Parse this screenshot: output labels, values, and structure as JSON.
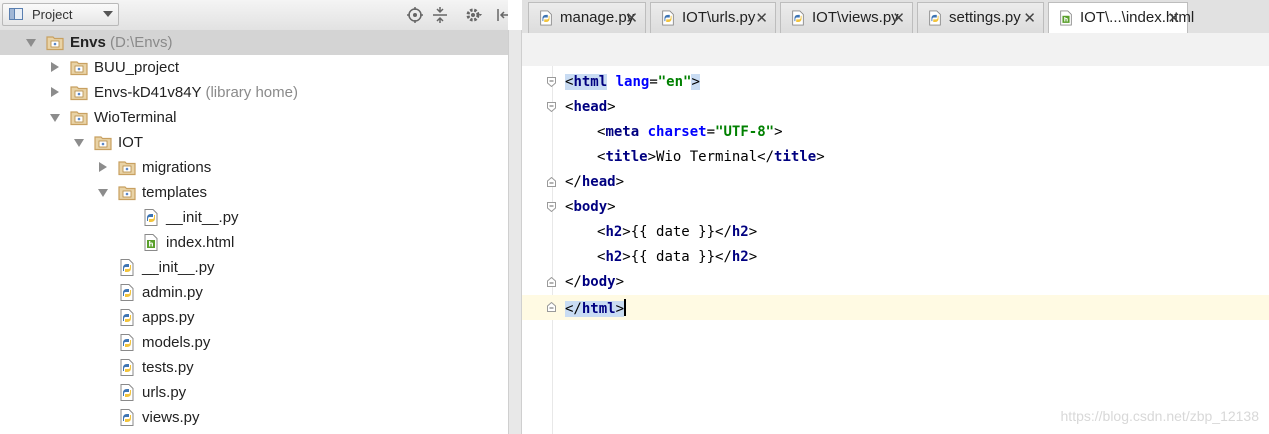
{
  "project_panel": {
    "view_selector": "Project",
    "tree": [
      {
        "name": "Envs",
        "hint": "(D:\\Envs)",
        "depth": 0,
        "kind": "folder",
        "expanded": true,
        "selected": true
      },
      {
        "name": "BUU_project",
        "hint": "",
        "depth": 1,
        "kind": "folder",
        "expanded": false
      },
      {
        "name": "Envs-kD41v84Y",
        "hint": "(library home)",
        "depth": 1,
        "kind": "folder",
        "expanded": false
      },
      {
        "name": "WioTerminal",
        "hint": "",
        "depth": 1,
        "kind": "folder",
        "expanded": true
      },
      {
        "name": "IOT",
        "hint": "",
        "depth": 2,
        "kind": "folder",
        "expanded": true
      },
      {
        "name": "migrations",
        "hint": "",
        "depth": 3,
        "kind": "folder",
        "expanded": false
      },
      {
        "name": "templates",
        "hint": "",
        "depth": 3,
        "kind": "folder",
        "expanded": true
      },
      {
        "name": "__init__.py",
        "hint": "",
        "depth": 4,
        "kind": "python"
      },
      {
        "name": "index.html",
        "hint": "",
        "depth": 4,
        "kind": "html"
      },
      {
        "name": "__init__.py",
        "hint": "",
        "depth": 3,
        "kind": "python"
      },
      {
        "name": "admin.py",
        "hint": "",
        "depth": 3,
        "kind": "python"
      },
      {
        "name": "apps.py",
        "hint": "",
        "depth": 3,
        "kind": "python"
      },
      {
        "name": "models.py",
        "hint": "",
        "depth": 3,
        "kind": "python"
      },
      {
        "name": "tests.py",
        "hint": "",
        "depth": 3,
        "kind": "python"
      },
      {
        "name": "urls.py",
        "hint": "",
        "depth": 3,
        "kind": "python"
      },
      {
        "name": "views.py",
        "hint": "",
        "depth": 3,
        "kind": "python"
      }
    ]
  },
  "tabs": [
    {
      "label": "manage.py",
      "kind": "python"
    },
    {
      "label": "IOT\\urls.py",
      "kind": "python"
    },
    {
      "label": "IOT\\views.py",
      "kind": "python"
    },
    {
      "label": "settings.py",
      "kind": "python"
    },
    {
      "label": "IOT\\...\\index.html",
      "kind": "html",
      "active": true
    }
  ],
  "code": [
    {
      "indent": 0,
      "tokens": [
        [
          "br",
          "<"
        ],
        [
          "tag",
          "html"
        ],
        [
          "br",
          " "
        ],
        [
          "attr",
          "lang"
        ],
        [
          "br",
          "="
        ],
        [
          "val",
          "\"en\""
        ],
        [
          "br",
          ">"
        ]
      ],
      "fold": "open",
      "match": true
    },
    {
      "indent": 0,
      "tokens": [
        [
          "br",
          "<"
        ],
        [
          "tag",
          "head"
        ],
        [
          "br",
          ">"
        ]
      ],
      "fold": "open"
    },
    {
      "indent": 1,
      "tokens": [
        [
          "br",
          "<"
        ],
        [
          "tag",
          "meta"
        ],
        [
          "br",
          " "
        ],
        [
          "attr",
          "charset"
        ],
        [
          "br",
          "="
        ],
        [
          "val",
          "\"UTF-8\""
        ],
        [
          "br",
          ">"
        ]
      ]
    },
    {
      "indent": 1,
      "tokens": [
        [
          "br",
          "<"
        ],
        [
          "tag",
          "title"
        ],
        [
          "br",
          ">Wio Terminal</"
        ],
        [
          "tag",
          "title"
        ],
        [
          "br",
          ">"
        ]
      ]
    },
    {
      "indent": 0,
      "tokens": [
        [
          "br",
          "</"
        ],
        [
          "tag",
          "head"
        ],
        [
          "br",
          ">"
        ]
      ],
      "fold": "close"
    },
    {
      "indent": 0,
      "tokens": [
        [
          "br",
          "<"
        ],
        [
          "tag",
          "body"
        ],
        [
          "br",
          ">"
        ]
      ],
      "fold": "open"
    },
    {
      "indent": 1,
      "tokens": [
        [
          "br",
          "<"
        ],
        [
          "tag",
          "h2"
        ],
        [
          "br",
          ">{{ date }}</"
        ],
        [
          "tag",
          "h2"
        ],
        [
          "br",
          ">"
        ]
      ]
    },
    {
      "indent": 1,
      "tokens": [
        [
          "br",
          "<"
        ],
        [
          "tag",
          "h2"
        ],
        [
          "br",
          ">{{ data }}</"
        ],
        [
          "tag",
          "h2"
        ],
        [
          "br",
          ">"
        ]
      ]
    },
    {
      "indent": 0,
      "tokens": [
        [
          "br",
          "</"
        ],
        [
          "tag",
          "body"
        ],
        [
          "br",
          ">"
        ]
      ],
      "fold": "close"
    },
    {
      "indent": 0,
      "tokens": [
        [
          "br",
          "</"
        ],
        [
          "tag",
          "html"
        ],
        [
          "br",
          ">"
        ]
      ],
      "fold": "close",
      "match": true,
      "current": true,
      "caret": true
    }
  ],
  "watermark": "https://blog.csdn.net/zbp_12138",
  "colors": {
    "selection": "#d4d4d4",
    "tag": "#000080",
    "attribute": "#0000ff",
    "string": "#008000",
    "current_line": "#fffae3",
    "folder": "#c8a060",
    "python_blue": "#3d74b3",
    "python_yellow": "#f2c43d",
    "html_green": "#5aa02c"
  }
}
